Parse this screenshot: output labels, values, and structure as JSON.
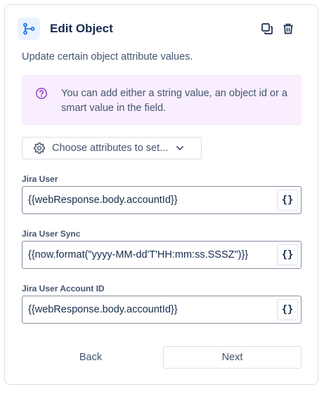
{
  "header": {
    "title": "Edit Object",
    "component_icon": "object-branch-icon",
    "actions": [
      {
        "name": "copy",
        "icon": "copy-icon"
      },
      {
        "name": "delete",
        "icon": "trash-icon"
      }
    ]
  },
  "description": "Update certain object attribute values.",
  "info": {
    "icon": "question-circle-icon",
    "text": "You can add either a string value, an object id or a smart value in the field."
  },
  "choose_button": {
    "icon": "gear-icon",
    "label": "Choose attributes to set...",
    "chevron": "chevron-down-icon"
  },
  "fields": [
    {
      "label": "Jira User",
      "value": "{{webResponse.body.accountId}}",
      "smart_value_label": "{}"
    },
    {
      "label": "Jira User Sync",
      "value": "{{now.format(\"yyyy-MM-dd'T'HH:mm:ss.SSSZ\")}}",
      "smart_value_label": "{}"
    },
    {
      "label": "Jira User Account ID",
      "value": "{{webResponse.body.accountId}}",
      "smart_value_label": "{}"
    }
  ],
  "footer": {
    "back_label": "Back",
    "next_label": "Next"
  },
  "colors": {
    "accent": "#0c66e4",
    "info_bg": "#f8eefe",
    "info_icon": "#9c50c6",
    "text": "#172b4d",
    "subtle_text": "#44546f",
    "border": "#dcdfe4"
  }
}
